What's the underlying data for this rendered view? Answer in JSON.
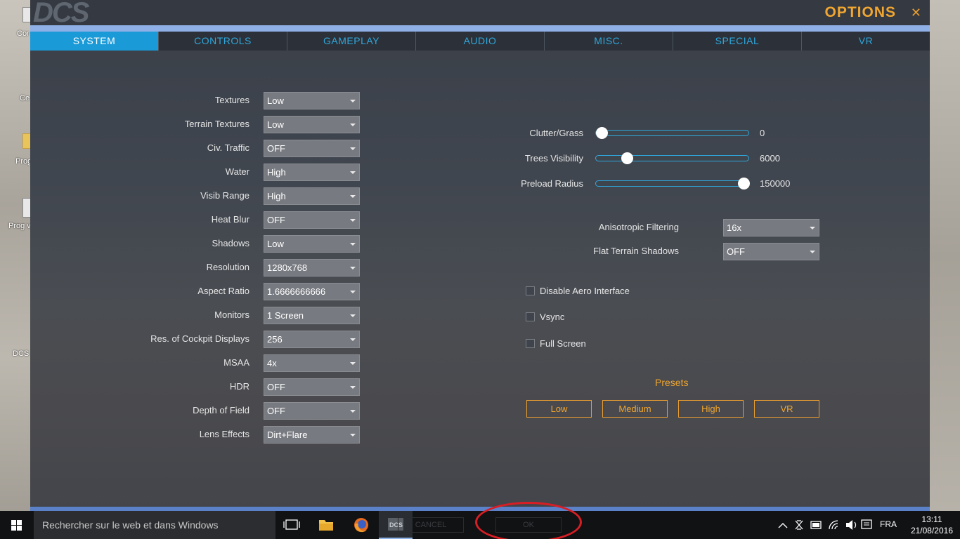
{
  "window": {
    "title": "OPTIONS",
    "logo": "DCS",
    "close": "✕"
  },
  "tabs": [
    {
      "label": "SYSTEM",
      "active": true
    },
    {
      "label": "CONTROLS"
    },
    {
      "label": "GAMEPLAY"
    },
    {
      "label": "AUDIO"
    },
    {
      "label": "MISC."
    },
    {
      "label": "SPECIAL"
    },
    {
      "label": "VR"
    }
  ],
  "settings": [
    {
      "label": "Textures",
      "value": "Low"
    },
    {
      "label": "Terrain Textures",
      "value": "Low"
    },
    {
      "label": "Civ. Traffic",
      "value": "OFF"
    },
    {
      "label": "Water",
      "value": "High"
    },
    {
      "label": "Visib Range",
      "value": "High"
    },
    {
      "label": "Heat Blur",
      "value": "OFF"
    },
    {
      "label": "Shadows",
      "value": "Low"
    },
    {
      "label": "Resolution",
      "value": "1280x768"
    },
    {
      "label": "Aspect Ratio",
      "value": "1.6666666666"
    },
    {
      "label": "Monitors",
      "value": "1 Screen"
    },
    {
      "label": "Res. of Cockpit Displays",
      "value": "256"
    },
    {
      "label": "MSAA",
      "value": "4x"
    },
    {
      "label": "HDR",
      "value": "OFF"
    },
    {
      "label": "Depth of Field",
      "value": "OFF"
    },
    {
      "label": "Lens Effects",
      "value": "Dirt+Flare"
    }
  ],
  "sliders": [
    {
      "label": "Clutter/Grass",
      "value": "0",
      "fraction": 0.0
    },
    {
      "label": "Trees Visibility",
      "value": "6000",
      "fraction": 0.18
    },
    {
      "label": "Preload Radius",
      "value": "150000",
      "fraction": 1.0
    }
  ],
  "right_selects": [
    {
      "label": "Anisotropic Filtering",
      "value": "16x"
    },
    {
      "label": "Flat Terrain Shadows",
      "value": "OFF"
    }
  ],
  "checkboxes": [
    {
      "label": "Disable Aero Interface",
      "checked": false
    },
    {
      "label": "Vsync",
      "checked": false
    },
    {
      "label": "Full Screen",
      "checked": false
    }
  ],
  "presets": {
    "title": "Presets",
    "buttons": [
      "Low",
      "Medium",
      "High",
      "VR"
    ]
  },
  "hidden_buttons": {
    "cancel": "CANCEL",
    "ok": "OK"
  },
  "desktop_icons": [
    {
      "label": "Cor"
    },
    {
      "label": "Ce Rac"
    },
    {
      "label": "Prog"
    },
    {
      "label": "Prog v"
    },
    {
      "label": "DCS"
    }
  ],
  "taskbar": {
    "search_placeholder": "Rechercher sur le web et dans Windows",
    "language": "FRA",
    "time": "13:11",
    "date": "21/08/2016"
  },
  "colors": {
    "accent_blue": "#1b9ad8",
    "accent_orange": "#f0a630",
    "annotation_red": "#d81e24"
  }
}
